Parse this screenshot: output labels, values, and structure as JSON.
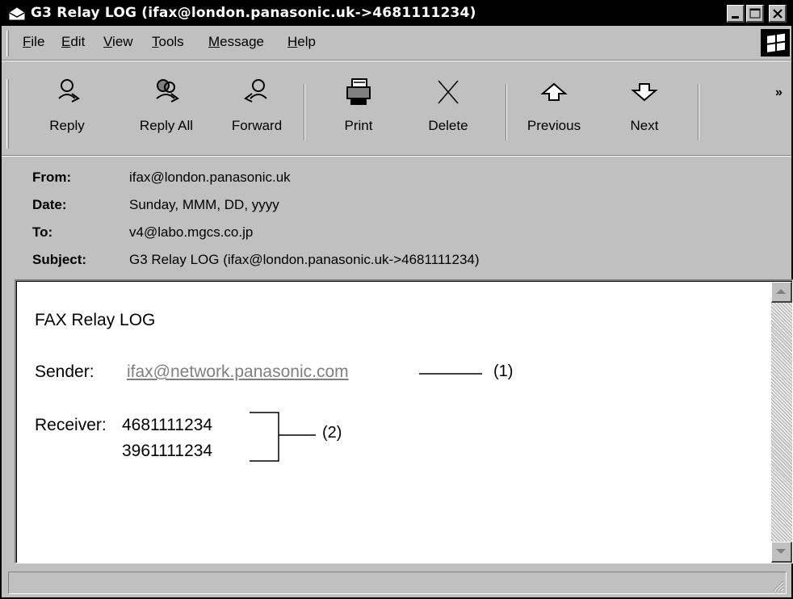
{
  "window": {
    "title": "G3 Relay LOG (ifax@london.panasonic.uk->4681111234)"
  },
  "menu": {
    "items": [
      {
        "first": "F",
        "rest": "ile"
      },
      {
        "first": "E",
        "rest": "dit"
      },
      {
        "first": "V",
        "rest": "iew"
      },
      {
        "first": "T",
        "rest": "ools"
      },
      {
        "first": "M",
        "rest": "essage"
      },
      {
        "first": "H",
        "rest": "elp"
      }
    ]
  },
  "toolbar": {
    "reply": "Reply",
    "reply_all": "Reply All",
    "forward": "Forward",
    "print": "Print",
    "delete": "Delete",
    "previous": "Previous",
    "next": "Next",
    "more": "»"
  },
  "headers": {
    "from_label": "From:",
    "from_value": "ifax@london.panasonic.uk",
    "date_label": "Date:",
    "date_value": "Sunday, MMM, DD, yyyy",
    "to_label": "To:",
    "to_value": "v4@labo.mgcs.co.jp",
    "subject_label": "Subject:",
    "subject_value": "G3 Relay LOG (ifax@london.panasonic.uk->4681111234)"
  },
  "message": {
    "heading": "FAX Relay LOG",
    "sender_label": "Sender:",
    "sender_value": "ifax@network.panasonic.com",
    "callout_1": "(1)",
    "receiver_label": "Receiver:",
    "receiver_1": "4681111234",
    "receiver_2": "3961111234",
    "callout_2": "(2)"
  },
  "icons": {
    "title": "envelope-icon",
    "reply": "reply-icon",
    "reply_all": "reply-all-icon",
    "forward": "forward-icon",
    "print": "printer-icon",
    "delete": "delete-x-icon",
    "previous": "up-arrow-icon",
    "next": "down-arrow-icon",
    "brand": "windows-flag-icon"
  }
}
